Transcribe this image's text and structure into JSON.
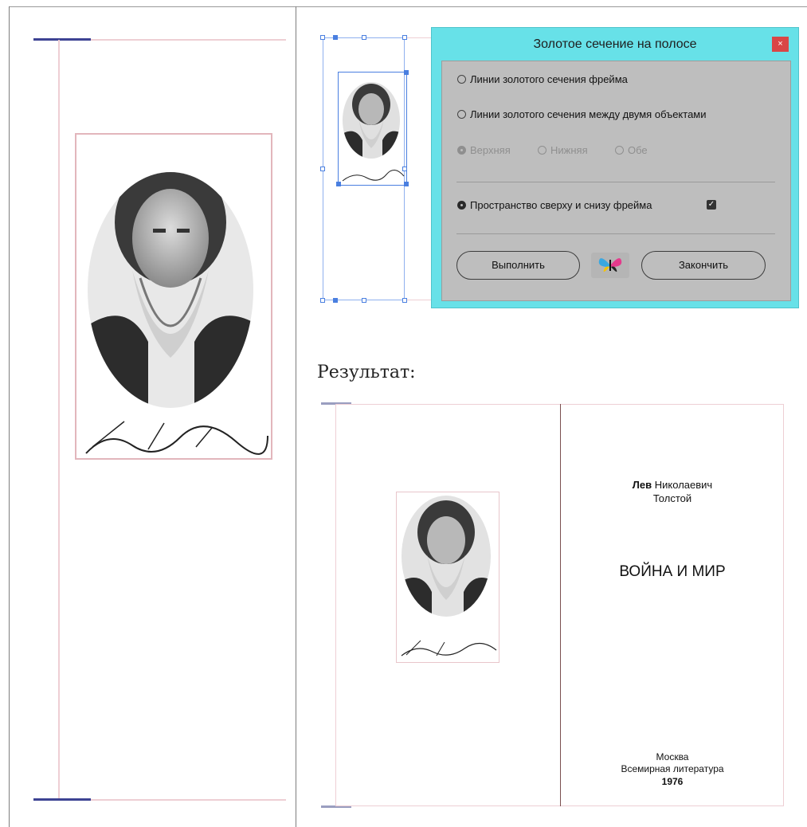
{
  "dialog": {
    "title": "Золотое сечение на полосе",
    "close_glyph": "×",
    "options": {
      "frame_lines": "Линии золотого сечения фрейма",
      "between_objects": "Линии золотого сечения между двумя объектами",
      "top": "Верхняя",
      "bottom": "Нижняя",
      "both": "Обе",
      "space_frame": "Пространство сверху и снизу фрейма"
    },
    "selected_option": "space_frame",
    "selected_sub_option": "top",
    "checkbox_checked": true,
    "buttons": {
      "run": "Выполнить",
      "finish": "Закончить"
    },
    "logo_icon": "butterfly-icon"
  },
  "result_label": "Результат:",
  "book": {
    "author_first": "Лев",
    "author_patronymic": "Николаевич",
    "author_last": "Толстой",
    "title": "ВОЙНА И МИР",
    "city": "Москва",
    "publisher": "Всемирная литература",
    "year": "1976"
  },
  "colors": {
    "dialog_border": "#67e1e8",
    "dialog_body": "#bebebe",
    "close_button": "#d94646",
    "guide_pink": "#eecfd4",
    "guide_navy": "#3d4393",
    "selection_blue": "#4a7fe0"
  }
}
